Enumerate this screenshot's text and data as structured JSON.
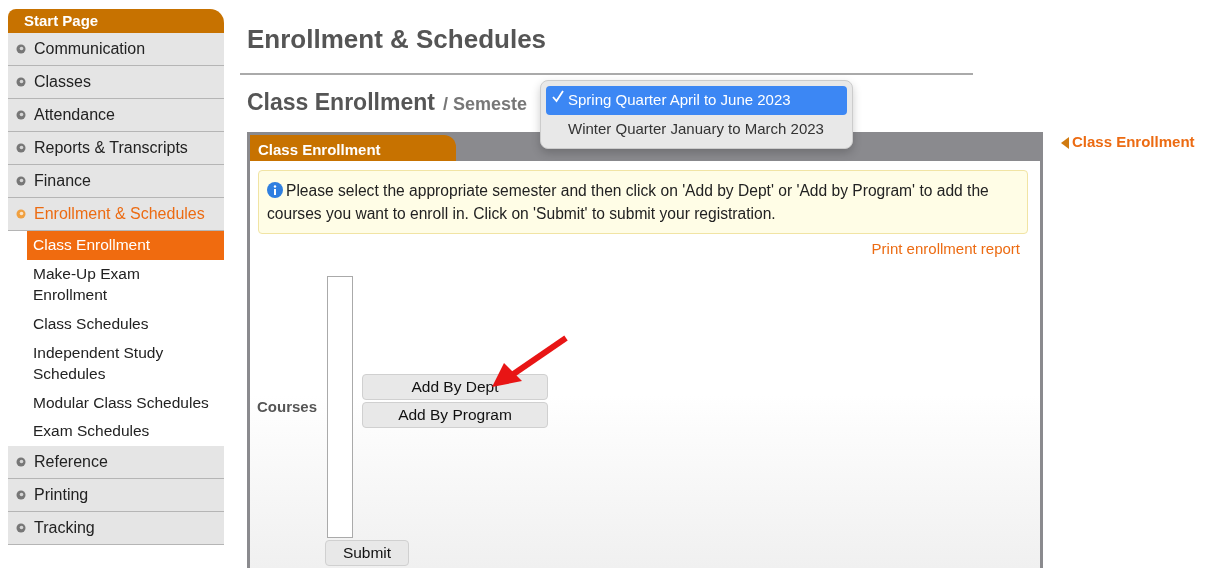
{
  "sidebar": {
    "header": "Start Page",
    "items": [
      {
        "label": "Communication",
        "selected": false
      },
      {
        "label": "Classes",
        "selected": false
      },
      {
        "label": "Attendance",
        "selected": false
      },
      {
        "label": "Reports & Transcripts",
        "selected": false
      },
      {
        "label": "Finance",
        "selected": false
      },
      {
        "label": "Enrollment & Schedules",
        "selected": true,
        "children": [
          {
            "label": "Class Enrollment",
            "selected": true
          },
          {
            "label": "Make-Up Exam Enrollment",
            "selected": false
          },
          {
            "label": "Class Schedules",
            "selected": false
          },
          {
            "label": "Independent Study Schedules",
            "selected": false
          },
          {
            "label": "Modular Class Schedules",
            "selected": false
          },
          {
            "label": "Exam Schedules",
            "selected": false
          }
        ]
      },
      {
        "label": "Reference",
        "selected": false
      },
      {
        "label": "Printing",
        "selected": false
      },
      {
        "label": "Tracking",
        "selected": false
      }
    ]
  },
  "page_title": "Enrollment & Schedules",
  "section": {
    "title": "Class Enrollment",
    "separator": "/",
    "semester_label": "Semeste",
    "semester_options": [
      {
        "label": "Spring Quarter April to June 2023",
        "selected": true
      },
      {
        "label": "Winter Quarter January to March 2023",
        "selected": false
      }
    ]
  },
  "panel": {
    "tab": "Class Enrollment",
    "info": "Please select the appropriate semester and then click on 'Add by Dept' or 'Add by Program' to add the courses you want to enroll in. Click on 'Submit' to submit your registration.",
    "print_link": "Print enrollment report",
    "courses_label": "Courses",
    "add_buttons": [
      "Add By Dept",
      "Add By Program"
    ],
    "submit": "Submit"
  },
  "side_link": "Class Enrollment"
}
